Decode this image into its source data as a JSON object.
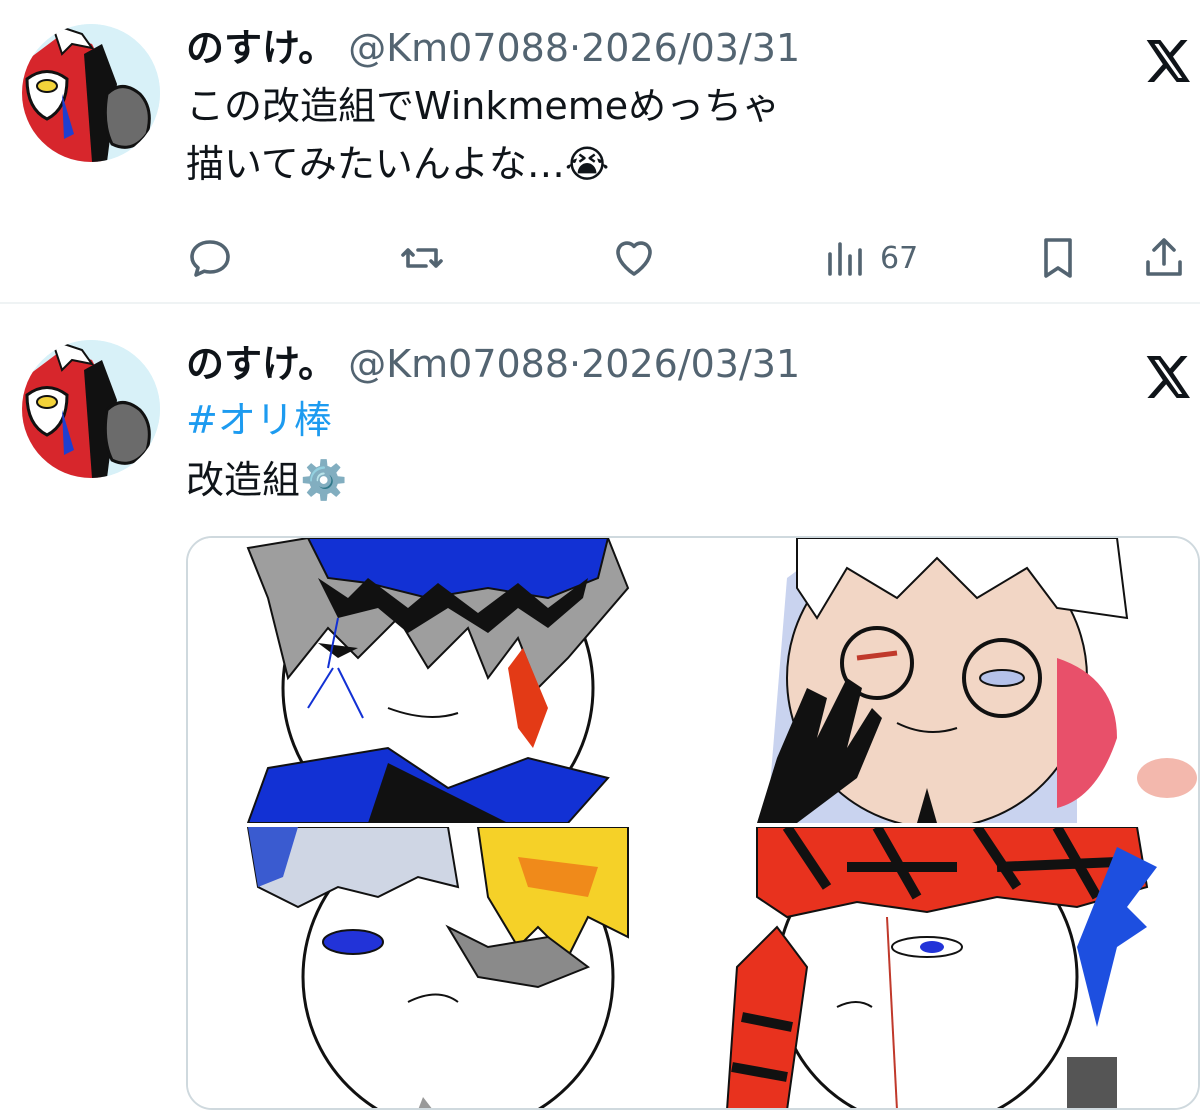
{
  "tweets": [
    {
      "author_name": "のすけ。",
      "handle": "@Km07088",
      "separator": "·",
      "date": "2026/03/31",
      "lines": [
        "この改造組でWinkmemeめっちゃ",
        "描いてみたいんよな…😭"
      ],
      "stats": {
        "views": "67"
      }
    },
    {
      "author_name": "のすけ。",
      "handle": "@Km07088",
      "separator": "·",
      "date": "2026/03/31",
      "hashtag": "#オリ棒",
      "line2": "改造組⚙️"
    }
  ],
  "icons": {
    "reply": "reply-icon",
    "repost": "repost-icon",
    "like": "heart-icon",
    "views": "views-icon",
    "bookmark": "bookmark-icon",
    "share": "share-icon",
    "x_logo": "x-logo-icon"
  },
  "colors": {
    "link": "#1d9bf0",
    "secondary_text": "#536471",
    "primary_text": "#0f1419"
  }
}
